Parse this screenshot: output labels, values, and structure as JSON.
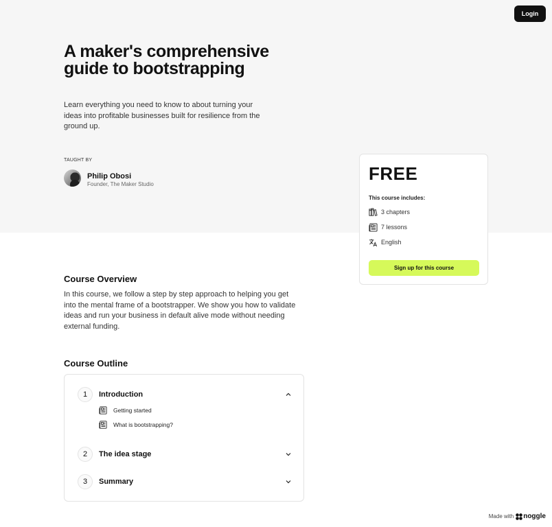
{
  "header": {
    "login_label": "Login"
  },
  "hero": {
    "title": "A maker's comprehensive guide to bootstrapping",
    "subtitle": "Learn everything you need to know to about turning your ideas into profitable businesses built for resilience from the ground up.",
    "taught_by_label": "TAUGHT BY",
    "instructor": {
      "name": "Philip Obosi",
      "role": "Founder, The Maker Studio"
    }
  },
  "card": {
    "price": "FREE",
    "includes_title": "This course includes:",
    "items": [
      {
        "icon": "books-icon",
        "label": "3 chapters"
      },
      {
        "icon": "newspaper-icon",
        "label": "7 lessons"
      },
      {
        "icon": "translate-icon",
        "label": "English"
      }
    ],
    "signup_label": "Sign up for this course",
    "accent_color": "#d6f95a"
  },
  "overview": {
    "title": "Course Overview",
    "text": "In this course, we follow a step by step approach to helping you get into the mental frame of a bootstrapper. We show you how to validate ideas and run your business in default alive mode without needing external funding."
  },
  "outline": {
    "title": "Course Outline",
    "modules": [
      {
        "number": "1",
        "title": "Introduction",
        "expanded": true,
        "lessons": [
          "Getting started",
          "What is bootstrapping?"
        ]
      },
      {
        "number": "2",
        "title": "The idea stage",
        "expanded": false
      },
      {
        "number": "3",
        "title": "Summary",
        "expanded": false
      }
    ]
  },
  "footer": {
    "made_with": "Made with",
    "brand": "noggle"
  }
}
